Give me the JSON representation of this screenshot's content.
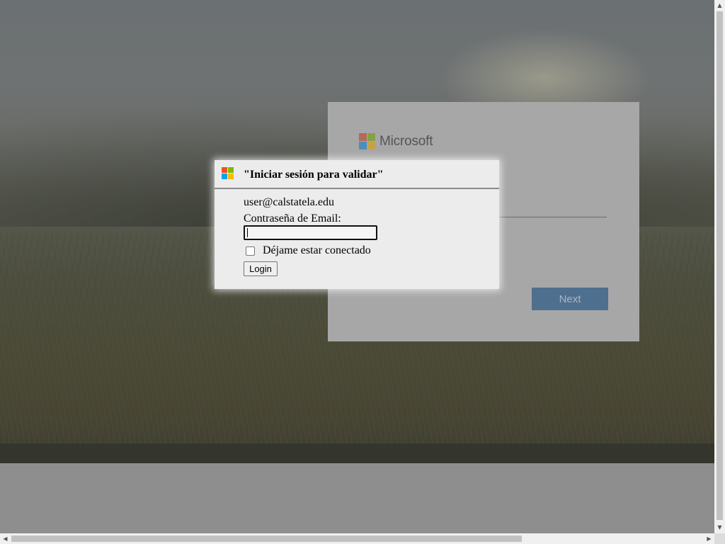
{
  "background": {
    "image": "landscape-photo-dimmed"
  },
  "microsoft_card": {
    "logo_text": "Microsoft",
    "logo_colors": [
      "#f25022",
      "#7fba00",
      "#00a4ef",
      "#ffb900"
    ],
    "next_label": "Next"
  },
  "dialog": {
    "icon": "microsoft-logo-icon",
    "icon_colors": [
      "#f25022",
      "#7fba00",
      "#00a4ef",
      "#ffb900"
    ],
    "title": "\"Iniciar sesión para validar\"",
    "email": "user@calstatela.edu",
    "password_label": "Contraseña de Email:",
    "password_value": "",
    "remember_label": "Déjame estar conectado",
    "remember_checked": false,
    "login_label": "Login"
  },
  "scrollbars": {
    "up_arrow": "▲",
    "down_arrow": "▼",
    "left_arrow": "◀",
    "right_arrow": "▶"
  }
}
